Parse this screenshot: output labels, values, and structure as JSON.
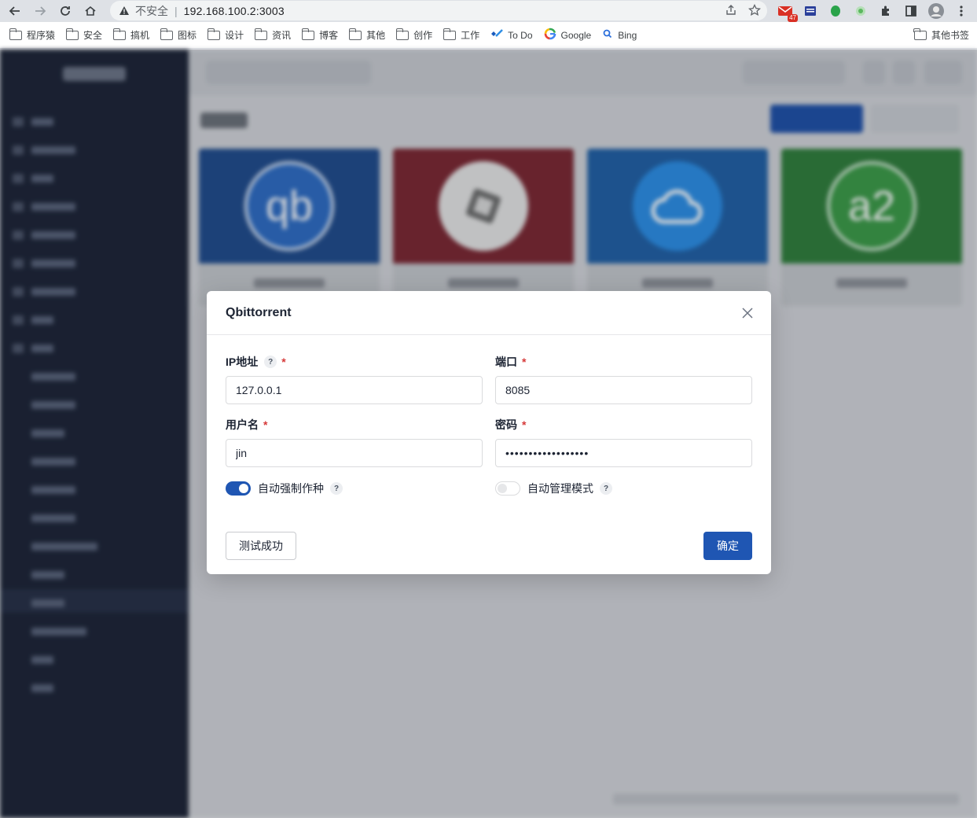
{
  "browser": {
    "security_label": "不安全",
    "url": "192.168.100.2:3003",
    "mail_badge": "47",
    "bookmarks": [
      "程序猿",
      "安全",
      "搞机",
      "图标",
      "设计",
      "资讯",
      "博客",
      "其他",
      "创作",
      "工作"
    ],
    "bookmark_todo": "To Do",
    "bookmark_google": "Google",
    "bookmark_bing": "Bing",
    "bookmark_other": "其他书签"
  },
  "dialog": {
    "title": "Qbittorrent",
    "ip_label": "IP地址",
    "ip_value": "127.0.0.1",
    "port_label": "端口",
    "port_value": "8085",
    "username_label": "用户名",
    "username_value": "jin",
    "password_label": "密码",
    "password_value": "••••••••••••••••••",
    "help_mark": "?",
    "required_mark": "*",
    "auto_force_label": "自动强制作种",
    "auto_force_on": true,
    "auto_manage_label": "自动管理模式",
    "auto_manage_on": false,
    "test_button": "测试成功",
    "confirm_button": "确定"
  },
  "background": {
    "card_letters": [
      "qb",
      "",
      "",
      "a2"
    ]
  },
  "colors": {
    "primary": "#1f56b3",
    "sidebar": "#1b2235",
    "required": "#d63939"
  }
}
